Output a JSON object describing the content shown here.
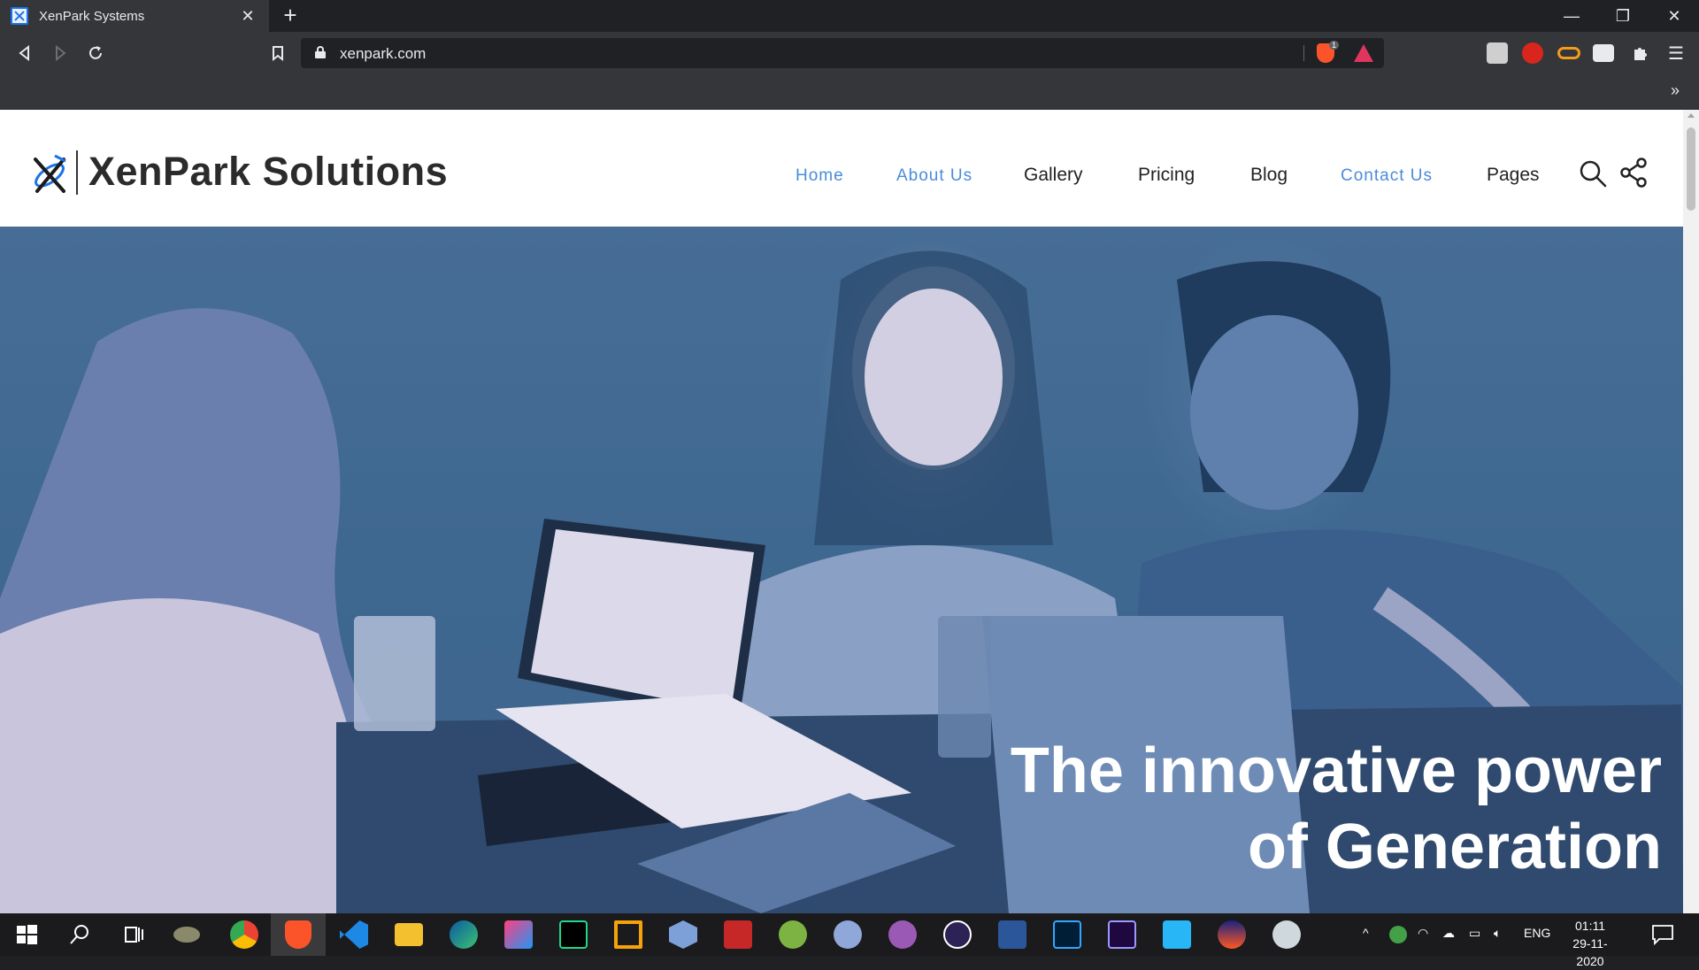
{
  "browser": {
    "tab": {
      "title": "XenPark Systems"
    },
    "url": "xenpark.com",
    "brave_badge": "1"
  },
  "site": {
    "brand": "XenPark Solutions",
    "nav": [
      {
        "label": "Home",
        "active": true
      },
      {
        "label": "About Us",
        "active": true
      },
      {
        "label": "Gallery",
        "active": false
      },
      {
        "label": "Pricing",
        "active": false
      },
      {
        "label": "Blog",
        "active": false
      },
      {
        "label": "Contact Us",
        "active": true
      },
      {
        "label": "Pages",
        "active": false
      }
    ],
    "hero": {
      "line1": "The innovative power",
      "line2": "of Generation"
    },
    "colors": {
      "nav_accent": "#4a8cd9",
      "hero_tint": "#3e6890"
    }
  },
  "taskbar": {
    "language": "ENG",
    "time": "01:11",
    "date": "29-11-2020"
  }
}
